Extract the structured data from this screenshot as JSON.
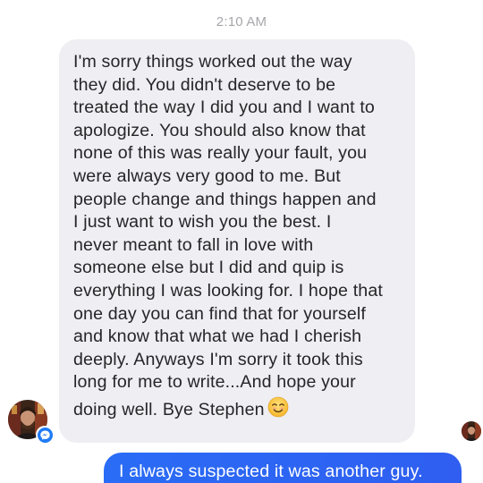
{
  "timestamp": "2:10 AM",
  "incoming_message": {
    "lines": [
      "I'm sorry things worked out the way",
      "they did. You didn't deserve to be",
      "treated the way I did you and I want to",
      "apologize. You should also know that",
      "none of this was really your fault, you",
      "were always very good to me. But",
      "people change and things happen and",
      "I just want to wish you the best.  I",
      "never meant to fall in love with",
      "someone else but I did and quip is",
      "everything I was looking for. I hope that",
      "one day you can find that for yourself",
      "and know that what we had I cherish",
      "deeply. Anyways I'm sorry it took this",
      "long for me to write...And hope your",
      "doing well. Bye Stephen"
    ],
    "emoji": "smiling-face-emoji"
  },
  "outgoing_message": {
    "text": "I always suspected it was another guy."
  },
  "colors": {
    "incoming_bubble": "#eeeef3",
    "outgoing_bubble": "#2f63f3",
    "timestamp": "#a7a7ab",
    "messenger_badge": "#1f7bf6"
  }
}
